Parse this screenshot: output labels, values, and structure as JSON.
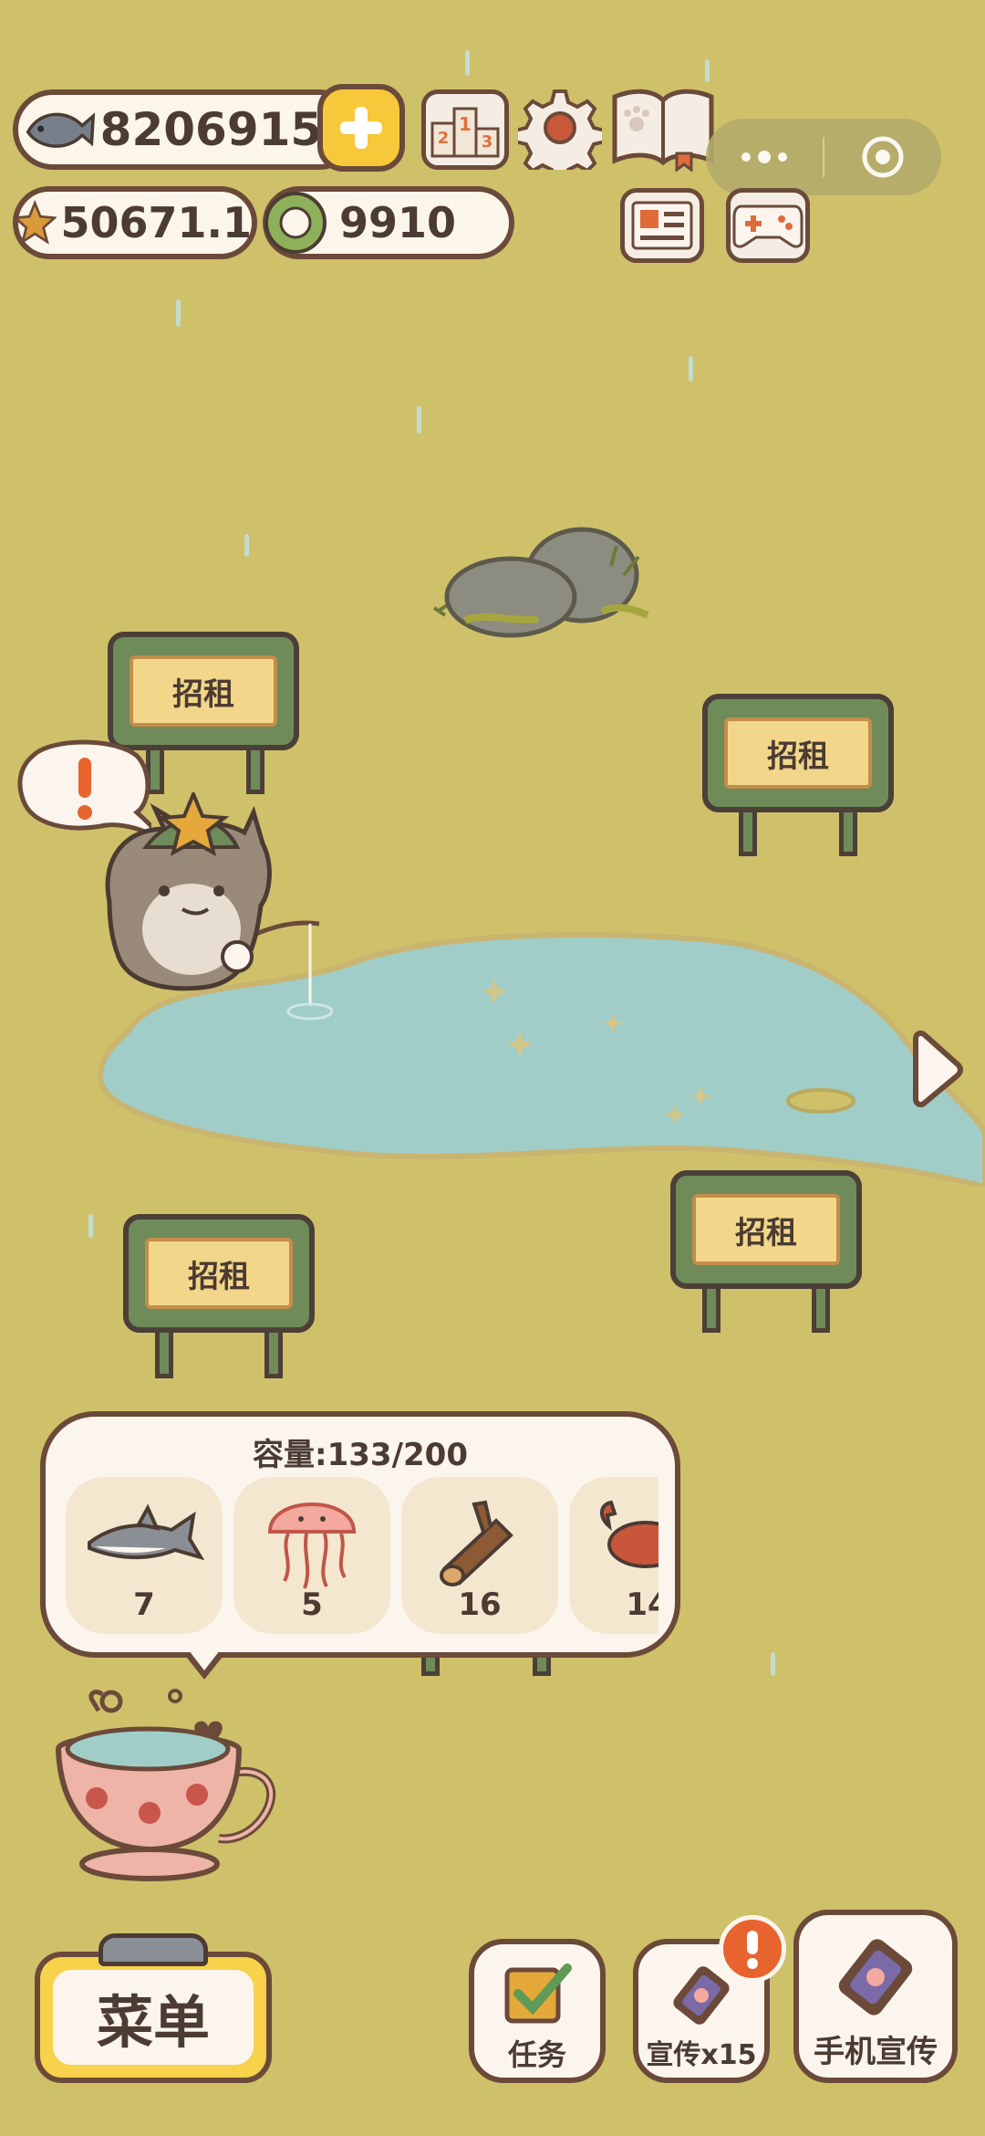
{
  "currency": {
    "fish": "82069153",
    "stars": "50671.1",
    "coins": "9910"
  },
  "signs": {
    "label": "招租"
  },
  "storage": {
    "capacity_text": "容量:133/200",
    "items": [
      {
        "icon": "shark-icon",
        "count": "7"
      },
      {
        "icon": "jellyfish-icon",
        "count": "5"
      },
      {
        "icon": "log-icon",
        "count": "16"
      },
      {
        "icon": "crab-icon",
        "count": "14"
      }
    ]
  },
  "buttons": {
    "menu": "菜单",
    "tasks": "任务",
    "promote": "宣传x15",
    "phone_promote": "手机宣传"
  },
  "colors": {
    "background": "#cfc06a",
    "pond": "#a0cdc7",
    "sign_green": "#6f8b5a",
    "alert_orange": "#e8642e",
    "menu_yellow": "#f7d24a"
  }
}
